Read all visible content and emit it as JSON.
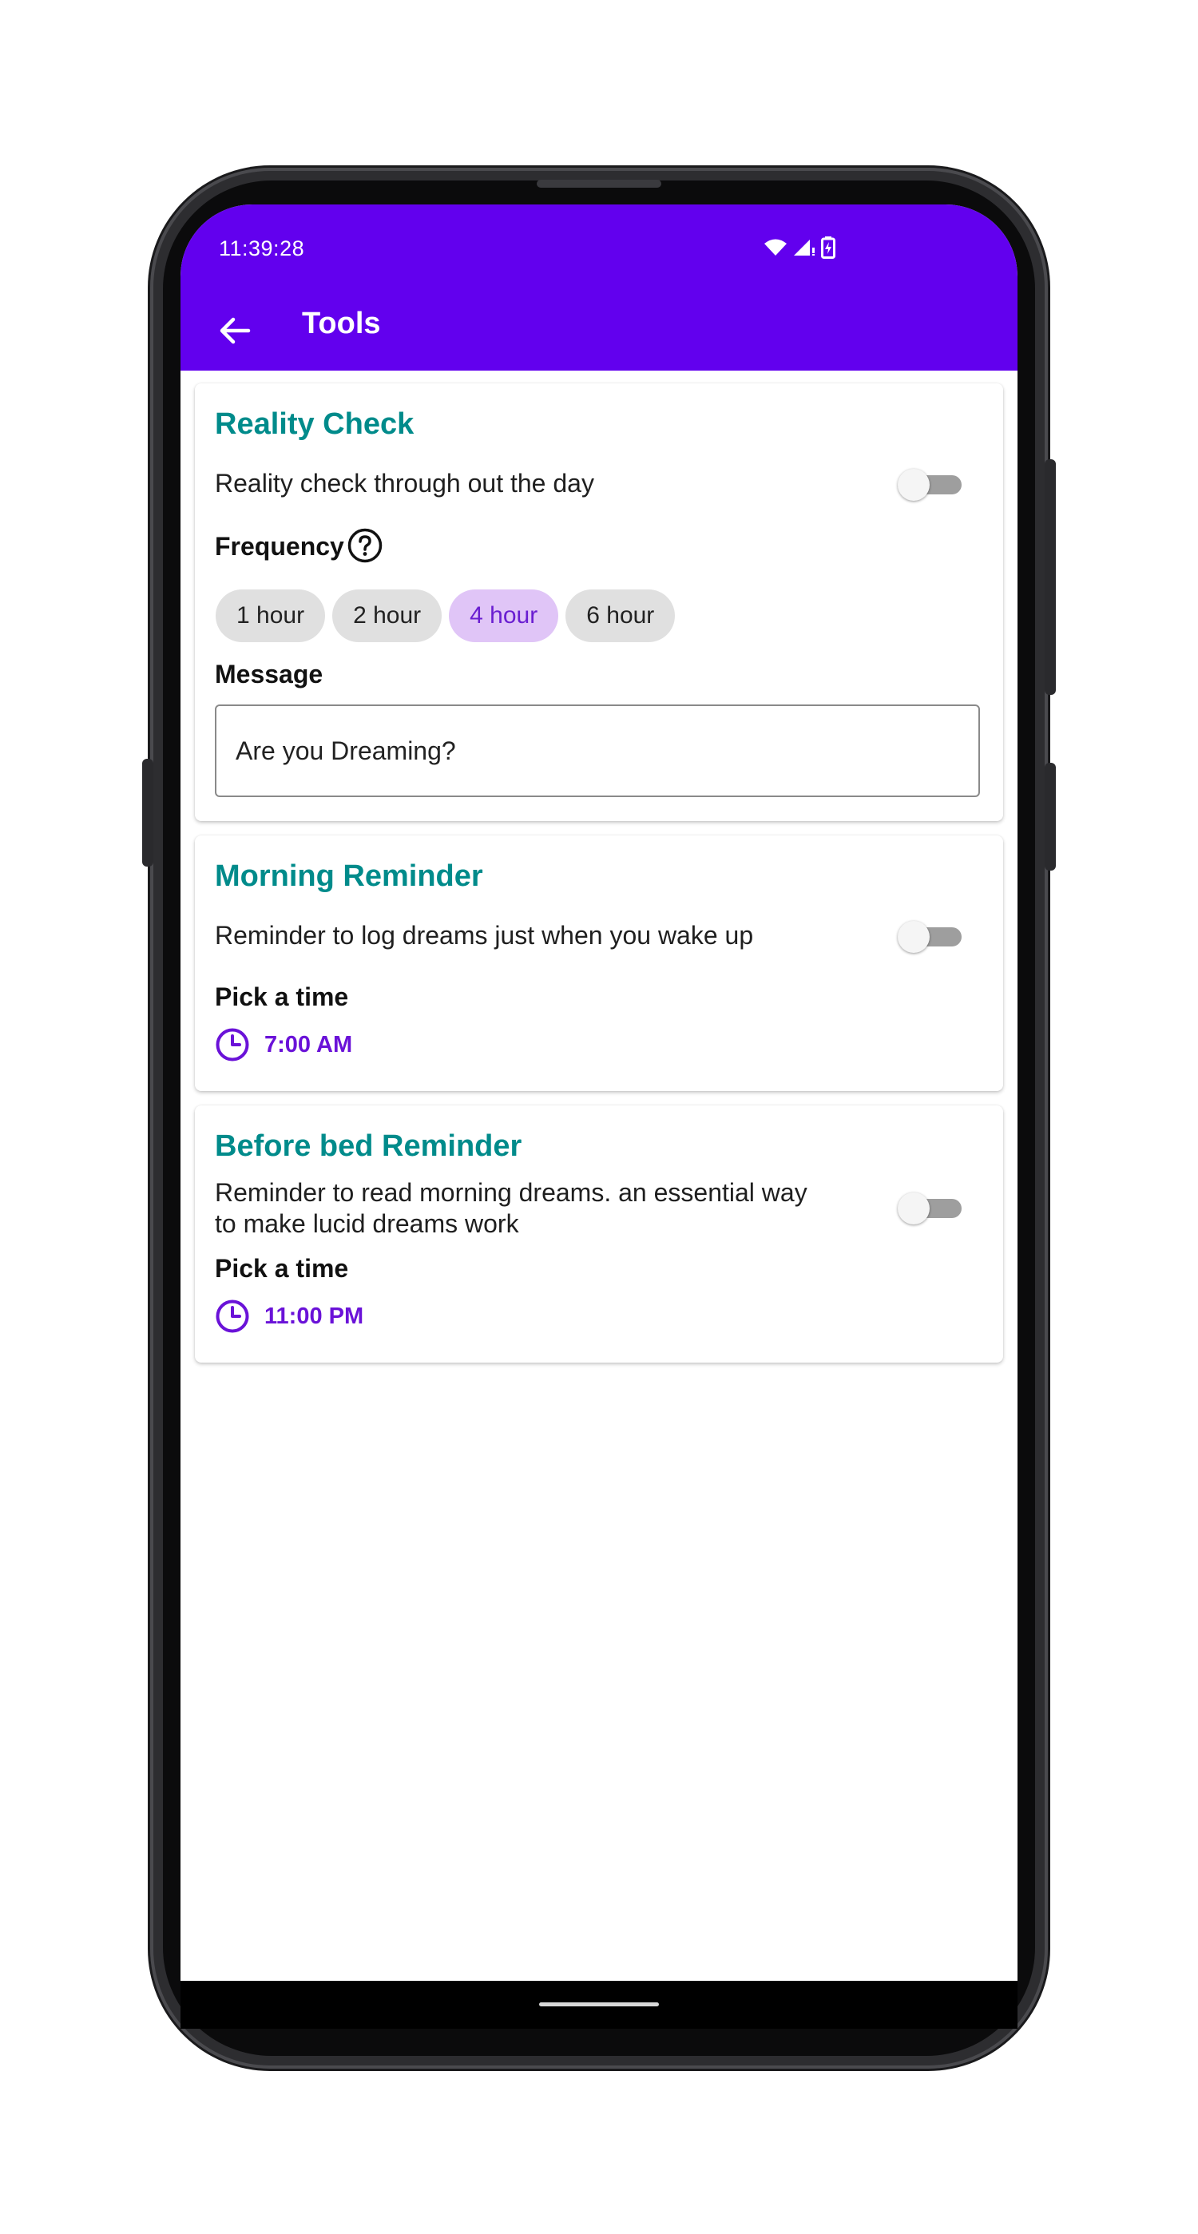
{
  "status_bar": {
    "time": "11:39:28"
  },
  "appbar": {
    "title": "Tools"
  },
  "reality_check": {
    "title": "Reality Check",
    "description": "Reality check through out the day",
    "enabled": false,
    "frequency_label": "Frequency",
    "chips": [
      "1 hour",
      "2 hour",
      "4 hour",
      "6 hour"
    ],
    "selected_chip": "4 hour",
    "message_label": "Message",
    "message_value": "Are you Dreaming?"
  },
  "morning_reminder": {
    "title": "Morning Reminder",
    "description": "Reminder to log dreams just when you wake up",
    "enabled": false,
    "pick_label": "Pick a time",
    "time": "7:00 AM"
  },
  "bed_reminder": {
    "title": "Before bed Reminder",
    "description_line1": "Reminder to read morning dreams. an essential way",
    "description_line2": "to make lucid dreams work",
    "enabled": false,
    "pick_label": "Pick a time",
    "time": "11:00 PM"
  },
  "colors": {
    "primary": "#6200ee",
    "section_title": "#008b8b",
    "time_accent": "#6a12d8",
    "chip_selected_bg": "#e0c5f7"
  },
  "icons": {
    "back": "arrow-left-icon",
    "help": "help-circle-icon",
    "clock": "clock-icon",
    "wifi": "wifi-icon",
    "signal": "signal-icon",
    "battery": "battery-charging-icon"
  }
}
